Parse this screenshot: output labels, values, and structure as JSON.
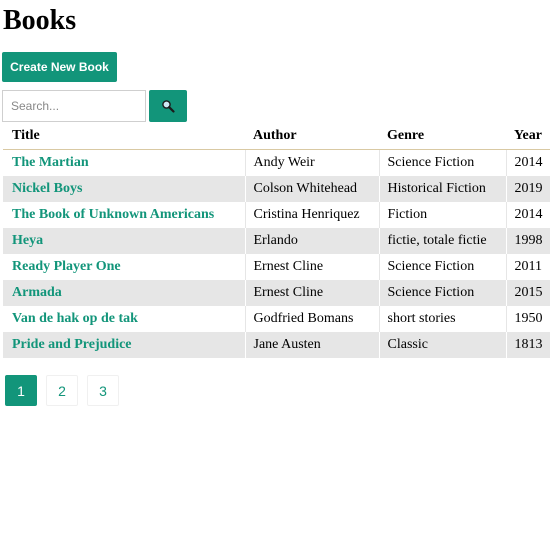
{
  "page": {
    "title": "Books"
  },
  "toolbar": {
    "create_label": "Create New Book"
  },
  "search": {
    "placeholder": "Search...",
    "button_icon": "magnifier-icon"
  },
  "table": {
    "headers": [
      "Title",
      "Author",
      "Genre",
      "Year"
    ],
    "rows": [
      {
        "title": "The Martian",
        "author": "Andy Weir",
        "genre": "Science Fiction",
        "year": "2014"
      },
      {
        "title": "Nickel Boys",
        "author": "Colson Whitehead",
        "genre": "Historical Fiction",
        "year": "2019"
      },
      {
        "title": "The Book of Unknown Americans",
        "author": "Cristina Henriquez",
        "genre": "Fiction",
        "year": "2014"
      },
      {
        "title": "Heya",
        "author": "Erlando",
        "genre": "fictie, totale fictie",
        "year": "1998"
      },
      {
        "title": "Ready Player One",
        "author": "Ernest Cline",
        "genre": "Science Fiction",
        "year": "2011"
      },
      {
        "title": "Armada",
        "author": "Ernest Cline",
        "genre": "Science Fiction",
        "year": "2015"
      },
      {
        "title": "Van de hak op de tak",
        "author": "Godfried Bomans",
        "genre": "short stories",
        "year": "1950"
      },
      {
        "title": "Pride and Prejudice",
        "author": "Jane Austen",
        "genre": "Classic",
        "year": "1813"
      }
    ]
  },
  "pagination": {
    "pages": [
      "1",
      "2",
      "3"
    ],
    "active": "1"
  },
  "colors": {
    "accent": "#12957a",
    "row_alt": "#e6e6e6",
    "header_rule": "#d9c9a3"
  }
}
